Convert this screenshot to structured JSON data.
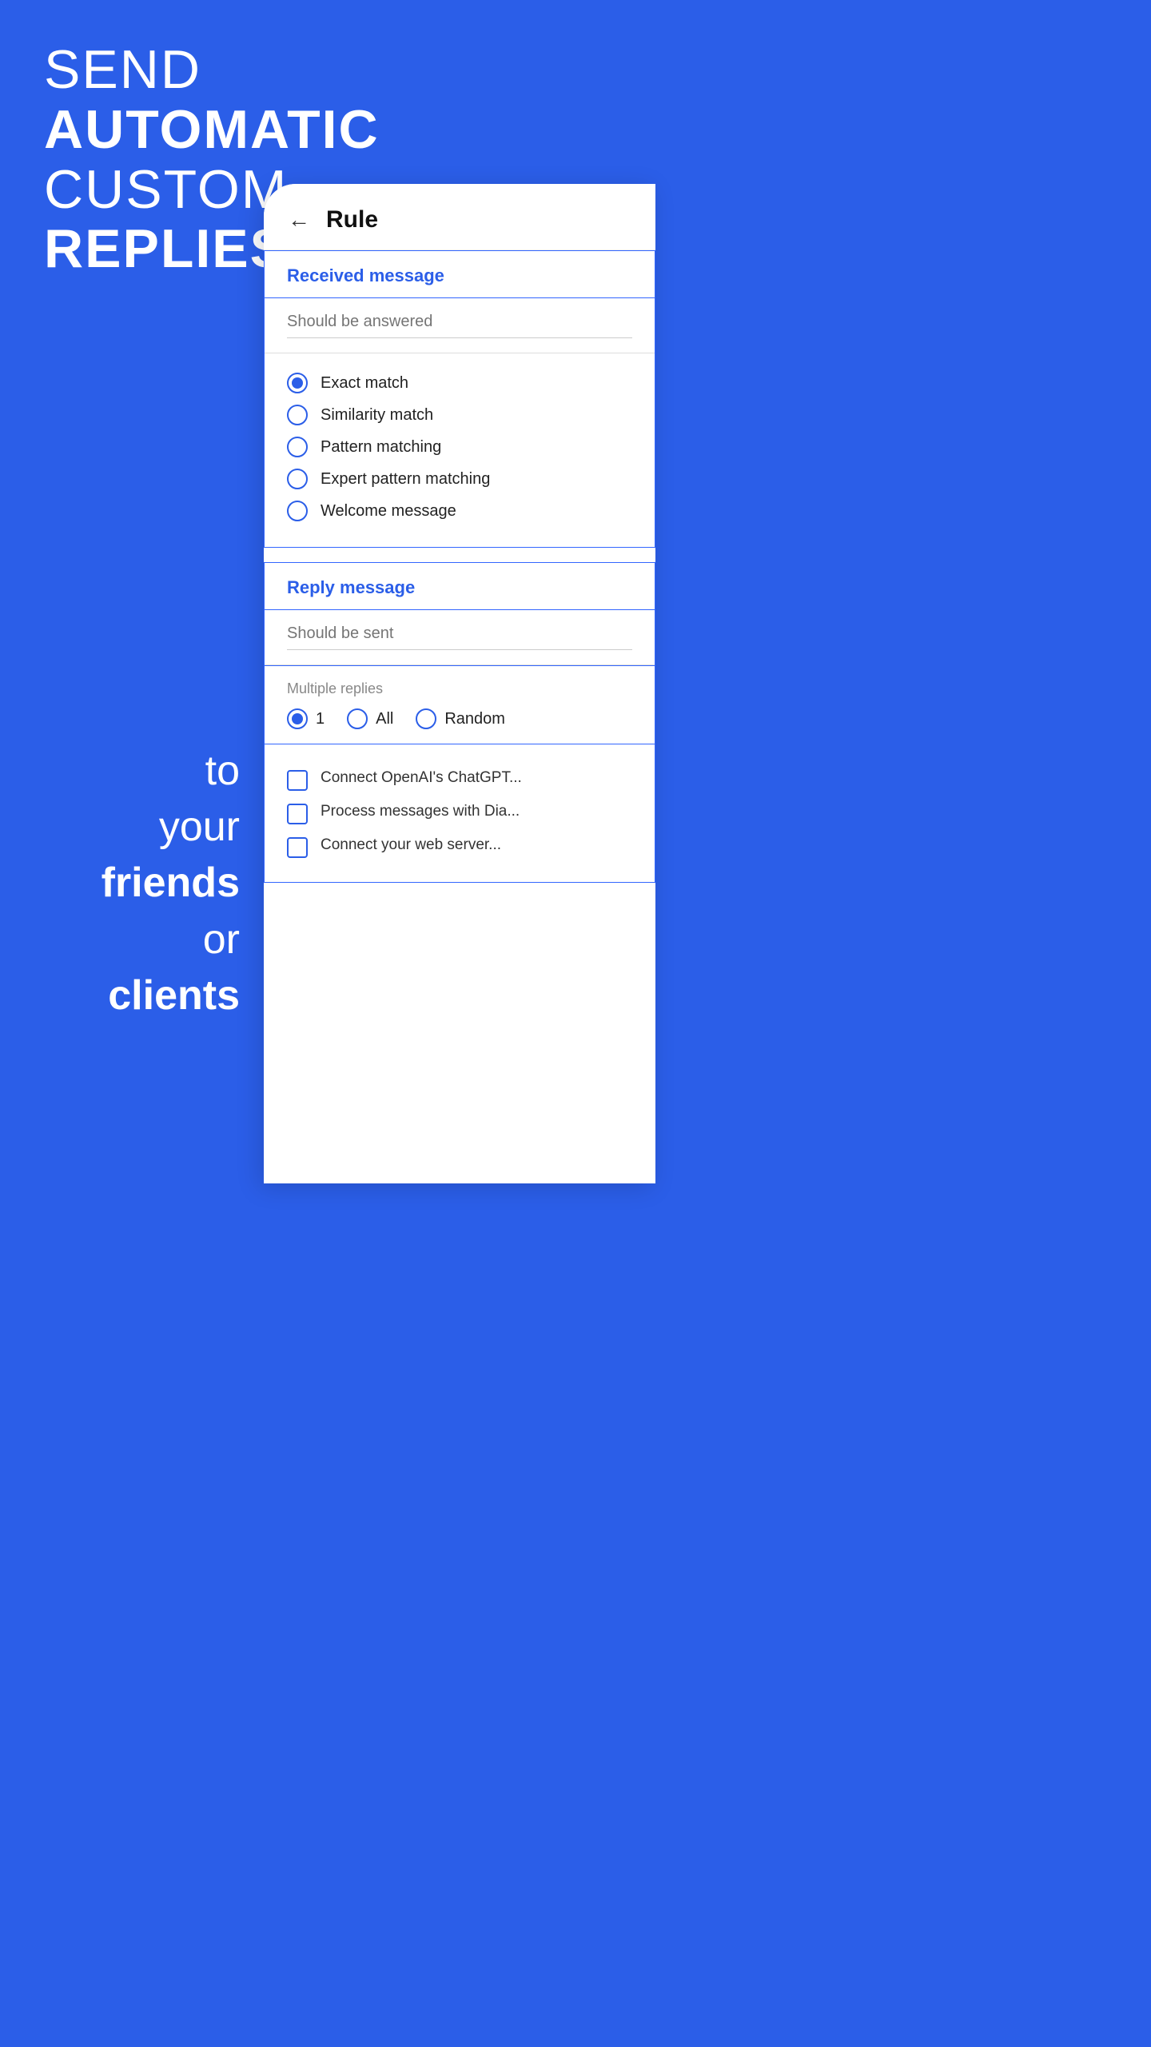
{
  "background_color": "#2B5EE8",
  "hero": {
    "line1": "SEND",
    "line2": "AUTOMATIC",
    "line3": "CUSTOM",
    "line4": "REPLIES"
  },
  "bottom_hero": {
    "line1": "to",
    "line2": "your",
    "line3": "friends",
    "line4": "or",
    "line5": "clients"
  },
  "card": {
    "back_label": "←",
    "title": "Rule",
    "received_message": {
      "section_label": "Received message",
      "input_placeholder": "Should be answered",
      "options": [
        {
          "id": "exact",
          "label": "Exact match",
          "selected": true
        },
        {
          "id": "similarity",
          "label": "Similarity match",
          "selected": false
        },
        {
          "id": "pattern",
          "label": "Pattern matching",
          "selected": false
        },
        {
          "id": "expert",
          "label": "Expert pattern matching",
          "selected": false
        },
        {
          "id": "welcome",
          "label": "Welcome message",
          "selected": false
        }
      ]
    },
    "reply_message": {
      "section_label": "Reply message",
      "input_placeholder": "Should be sent"
    },
    "multiple_replies": {
      "section_label": "Multiple replies",
      "options": [
        {
          "id": "one",
          "label": "1",
          "selected": true
        },
        {
          "id": "all",
          "label": "All",
          "selected": false
        },
        {
          "id": "random",
          "label": "Random",
          "selected": false
        }
      ]
    },
    "checkboxes": [
      {
        "id": "chatgpt",
        "label": "Connect OpenAI's ChatGPT..."
      },
      {
        "id": "dia",
        "label": "Process messages with Dia..."
      },
      {
        "id": "server",
        "label": "Connect your web server..."
      }
    ]
  }
}
